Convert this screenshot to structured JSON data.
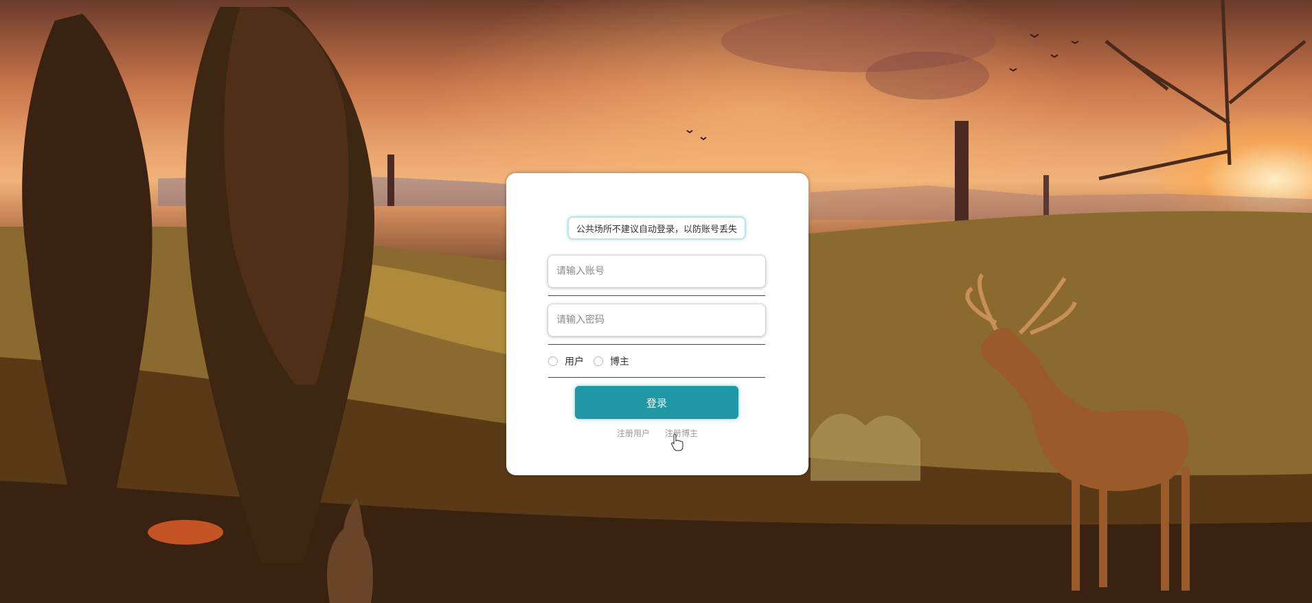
{
  "login": {
    "notice": "公共场所不建议自动登录，以防账号丢失",
    "account_placeholder": "请输入账号",
    "password_placeholder": "请输入密码",
    "role_options": [
      "用户",
      "博主"
    ],
    "login_button": "登录",
    "register_user_link": "注册用户",
    "register_blogger_link": "注册博主"
  },
  "background": {
    "description_icon": "autumn-sunset-landscape-with-deer",
    "accent_color": "#1f97a5"
  },
  "cursor": "hand-pointer-icon"
}
